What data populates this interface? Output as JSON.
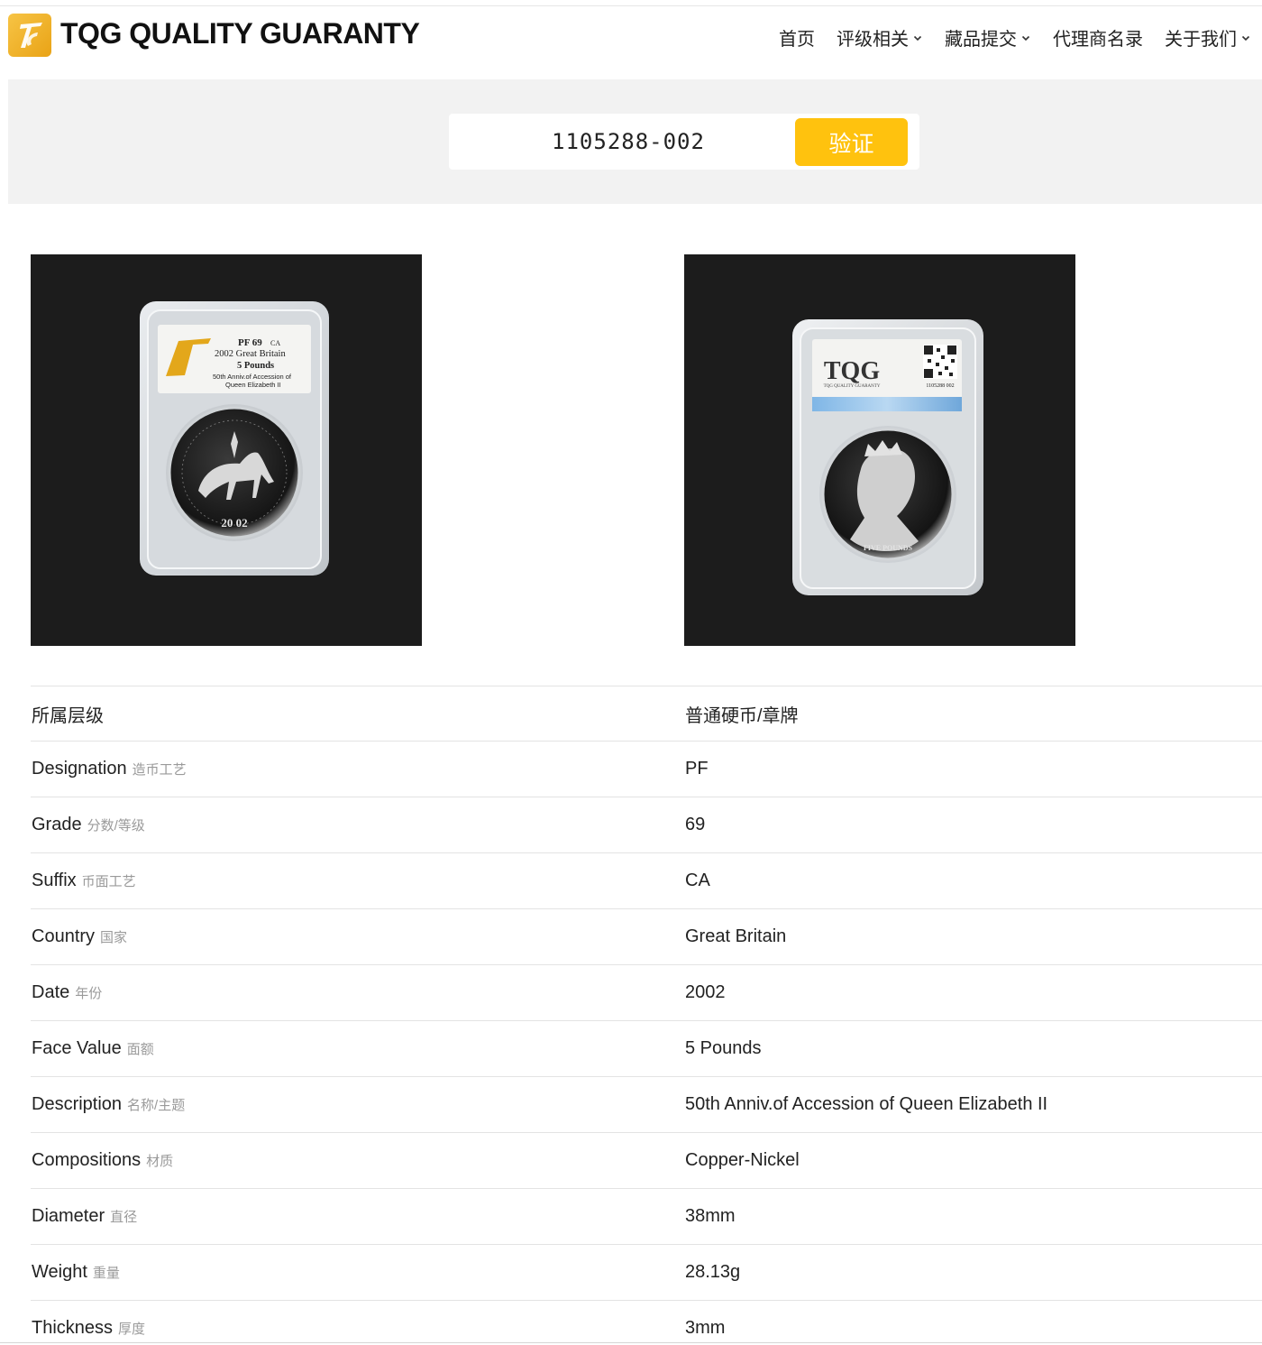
{
  "header": {
    "brand": "TQG QUALITY GUARANTY",
    "logo_icon": "tqg-logo-icon",
    "nav": [
      {
        "label": "首页",
        "dropdown": false
      },
      {
        "label": "评级相关",
        "dropdown": true
      },
      {
        "label": "藏品提交",
        "dropdown": true
      },
      {
        "label": "代理商名录",
        "dropdown": false
      },
      {
        "label": "关于我们",
        "dropdown": true
      }
    ]
  },
  "search": {
    "value": "1105288-002",
    "button_label": "验证"
  },
  "photos": {
    "obverse": {
      "label_grade": "PF 69",
      "label_suffix": "CA",
      "label_line2": "2002 Great Britain",
      "label_line3": "5 Pounds",
      "label_line4": "50th Anniv.of Accession of",
      "label_line5": "Queen Elizabeth II",
      "coin_year": "20  02"
    },
    "reverse": {
      "brand": "TQG",
      "brand_sub": "TQG QUALITY GUARANTY",
      "cert_no": "1105288 002",
      "coin_text": "FIVE POUNDS"
    }
  },
  "details": [
    {
      "label": "所属层级",
      "label_cn": "",
      "value": "普通硬币/章牌"
    },
    {
      "label": "Designation",
      "label_cn": "造币工艺",
      "value": "PF"
    },
    {
      "label": "Grade",
      "label_cn": "分数/等级",
      "value": "69"
    },
    {
      "label": "Suffix",
      "label_cn": "币面工艺",
      "value": "CA"
    },
    {
      "label": "Country",
      "label_cn": "国家",
      "value": "Great Britain"
    },
    {
      "label": "Date",
      "label_cn": "年份",
      "value": "2002"
    },
    {
      "label": "Face Value",
      "label_cn": "面额",
      "value": "5 Pounds"
    },
    {
      "label": "Description",
      "label_cn": "名称/主题",
      "value": "50th Anniv.of Accession of Queen Elizabeth II"
    },
    {
      "label": "Compositions",
      "label_cn": "材质",
      "value": "Copper-Nickel"
    },
    {
      "label": "Diameter",
      "label_cn": "直径",
      "value": "38mm"
    },
    {
      "label": "Weight",
      "label_cn": "重量",
      "value": "28.13g"
    },
    {
      "label": "Thickness",
      "label_cn": "厚度",
      "value": "3mm"
    }
  ],
  "colors": {
    "accent": "#ffc20e",
    "logo": "#f0b22a",
    "band": "#f2f2f2",
    "photo_bg": "#1c1c1c"
  }
}
